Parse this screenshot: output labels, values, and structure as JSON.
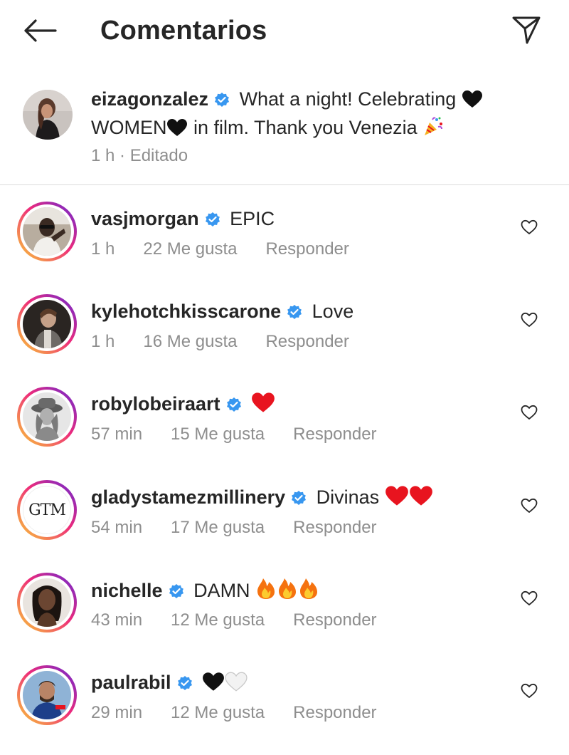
{
  "header": {
    "title": "Comentarios"
  },
  "caption": {
    "username": "eizagonzalez",
    "text_line1": "What a night! Celebrating",
    "text_line2_a": "WOMEN",
    "text_line2_b": "in film. Thank you Venezia",
    "time": "1 h",
    "separator": " · ",
    "edited": "Editado"
  },
  "comments": [
    {
      "username": "vasjmorgan",
      "text": "EPIC",
      "time": "1 h",
      "likes": "22 Me gusta",
      "reply": "Responder"
    },
    {
      "username": "kylehotchkisscarone",
      "text": "Love",
      "time": "1 h",
      "likes": "16 Me gusta",
      "reply": "Responder"
    },
    {
      "username": "robylobeiraart",
      "text": "",
      "time": "57 min",
      "likes": "15 Me gusta",
      "reply": "Responder"
    },
    {
      "username": "gladystamezmillinery",
      "text": "Divinas",
      "time": "54 min",
      "likes": "17 Me gusta",
      "reply": "Responder"
    },
    {
      "username": "nichelle",
      "text": "DAMN",
      "time": "43 min",
      "likes": "12 Me gusta",
      "reply": "Responder"
    },
    {
      "username": "paulrabil",
      "text": "",
      "time": "29 min",
      "likes": "12 Me gusta",
      "reply": "Responder"
    }
  ],
  "avatar_logo_text": "GTM",
  "colors": {
    "verified": "#3897f0",
    "meta": "#8e8e8e",
    "text": "#262626",
    "red_heart": "#e8141f"
  },
  "icons": [
    "back-arrow-icon",
    "send-icon",
    "verified-badge-icon",
    "like-heart-icon",
    "black-heart-icon",
    "red-heart-icon",
    "fire-icon",
    "white-heart-icon",
    "party-popper-icon"
  ]
}
